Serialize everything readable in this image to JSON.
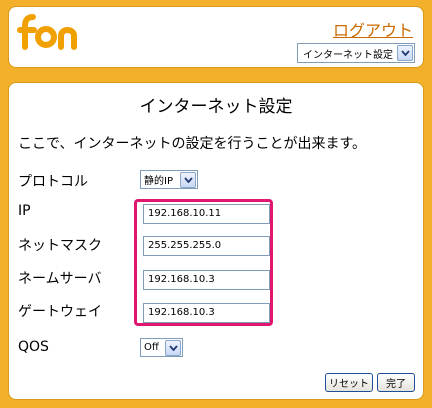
{
  "header": {
    "logo_text": "fon",
    "logout_label": "ログアウト",
    "page_select_value": "インターネット設定"
  },
  "main": {
    "title": "インターネット設定",
    "description": "ここで、インターネットの設定を行うことが出来ます。",
    "protocol": {
      "label": "プロトコル",
      "value": "静的IP"
    },
    "ip": {
      "label": "IP",
      "value": "192.168.10.11"
    },
    "netmask": {
      "label": "ネットマスク",
      "value": "255.255.255.0"
    },
    "nameserver": {
      "label": "ネームサーバ",
      "value": "192.168.10.3"
    },
    "gateway": {
      "label": "ゲートウェイ",
      "value": "192.168.10.3"
    },
    "qos": {
      "label": "QOS",
      "value": "Off"
    }
  },
  "buttons": {
    "reset_label": "リセット",
    "done_label": "完了"
  },
  "colors": {
    "background": "#f3b12b",
    "logo": "#f0a000",
    "link": "#cc6a00",
    "highlight": "#e0166f"
  },
  "icons": {
    "dropdown": "chevron-down-icon"
  }
}
